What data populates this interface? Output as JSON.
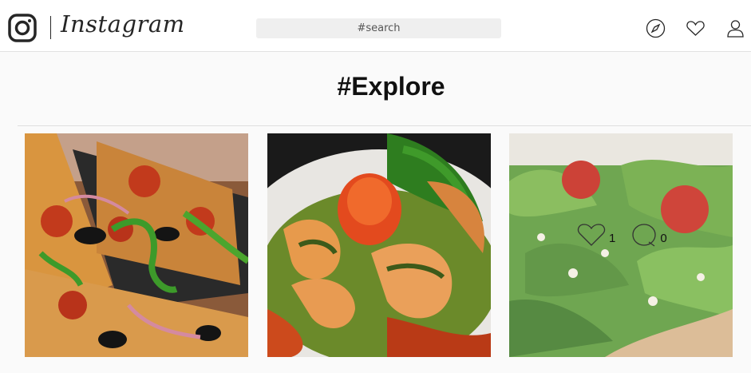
{
  "app": {
    "wordmark": "Instagram",
    "icons": {
      "logo": "instagram-logo-icon",
      "explore": "compass-icon",
      "activity": "heart-icon",
      "profile": "user-icon"
    }
  },
  "search": {
    "placeholder": "#search"
  },
  "page": {
    "title": "#Explore"
  },
  "posts": [
    {
      "subject": "pizza",
      "likes": "",
      "comments": ""
    },
    {
      "subject": "shrimp",
      "likes": "",
      "comments": ""
    },
    {
      "subject": "salad",
      "likes": "1",
      "comments": "0"
    }
  ],
  "colors": {
    "topbar": "#ffffff",
    "background": "#fafafa",
    "text": "#262626"
  }
}
